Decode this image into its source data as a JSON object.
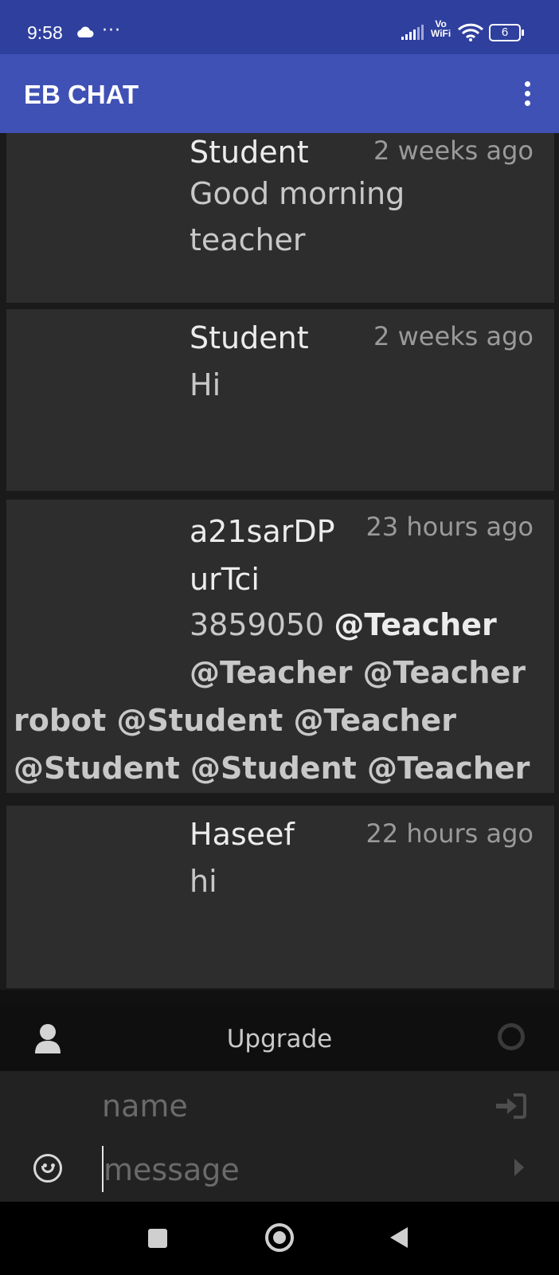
{
  "status_bar": {
    "time": "9:58",
    "overflow": "···",
    "network": "Vo WiFi",
    "network_line1": "Vo",
    "network_line2": "WiFi",
    "battery": "6",
    "icons": [
      "cloud-icon",
      "signal-icon",
      "wifi-icon",
      "battery-icon"
    ]
  },
  "app_bar": {
    "title": "EB CHAT",
    "menu_icon": "more-vert-icon"
  },
  "messages": [
    {
      "sender": "Student",
      "time": "2 weeks ago",
      "text_line1": "Good morning",
      "text_line2": "teacher"
    },
    {
      "sender": "Student",
      "time": "2 weeks ago",
      "text": "Hi"
    },
    {
      "sender_line1": "a21sarDP",
      "sender_line2": "urTci",
      "time": "23 hours ago",
      "text_prefix": "3859050 ",
      "mention_1": "@Teacher",
      "mention_2": "@Teacher @Teacher",
      "mention_3": "robot @Student @Teacher",
      "mention_4": "@Student @Student @Teacher"
    },
    {
      "sender": "Haseef",
      "time": "22 hours ago",
      "text": "hi"
    }
  ],
  "controls": {
    "upgrade_label": "Upgrade",
    "name_placeholder": "name",
    "message_placeholder": "message",
    "icons": [
      "user-icon",
      "status-circle-icon",
      "login-icon",
      "emoji-icon",
      "send-icon"
    ]
  },
  "colors": {
    "status_bar": "#2f3f9e",
    "app_bar": "#3f51b5",
    "message_bg": "#2d2d2d"
  }
}
